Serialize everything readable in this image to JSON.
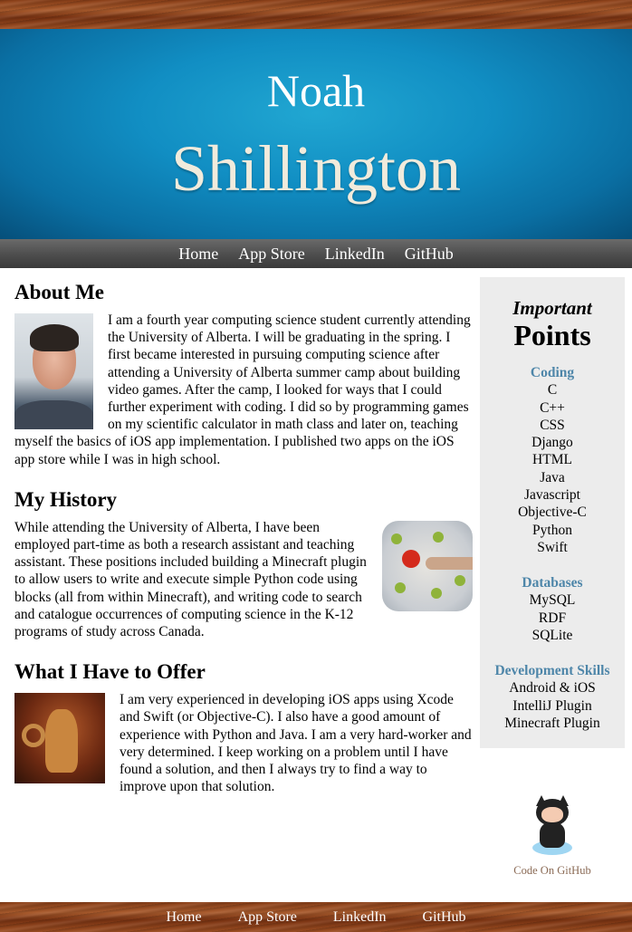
{
  "hero": {
    "first_name": "Noah",
    "last_name": "Shillington"
  },
  "nav": {
    "home": "Home",
    "app_store": "App Store",
    "linkedin": "LinkedIn",
    "github": "GitHub"
  },
  "about": {
    "heading": "About Me",
    "text": "I am a fourth year computing science student currently attending the University of Alberta. I will be graduating in the spring. I first became interested in pursuing computing science after attending a University of Alberta summer camp about building video games. After the camp, I looked for ways that I could further experiment with coding. I did so by programming games on my scientific calculator in math class and later on, teaching myself the basics of iOS app implementation. I published two apps on the iOS app store while I was in high school."
  },
  "history": {
    "heading": "My History",
    "text": "While attending the University of Alberta, I have been employed part-time as both a research assistant and teaching assistant. These positions included building a Minecraft plugin to allow users to write and execute simple Python code using blocks (all from within Minecraft), and writing code to search and catalogue occurrences of computing science in the K-12 programs of study across Canada."
  },
  "offer": {
    "heading": "What I Have to Offer",
    "text": "I am very experienced in developing iOS apps using Xcode and Swift (or Objective-C). I also have a good amount of experience with Python and Java. I am a very hard-worker and very determined. I keep working on a problem until I have found a solution, and then I always try to find a way to improve upon that solution."
  },
  "sidebar": {
    "title_line1": "Important",
    "title_line2": "Points",
    "groups": [
      {
        "heading": "Coding",
        "items": [
          "C",
          "C++",
          "CSS",
          "Django",
          "HTML",
          "Java",
          "Javascript",
          "Objective-C",
          "Python",
          "Swift"
        ]
      },
      {
        "heading": "Databases",
        "items": [
          "MySQL",
          "RDF",
          "SQLite"
        ]
      },
      {
        "heading": "Development Skills",
        "items": [
          "Android & iOS",
          "IntelliJ Plugin",
          "Minecraft Plugin"
        ]
      }
    ]
  },
  "github_badge": {
    "label": "Code On GitHub",
    "icon": "octocat-icon"
  },
  "colors": {
    "hero_blue": "#118ec3",
    "sidebar_heading": "#4e86a9",
    "sidebar_bg": "#ececec",
    "wood": "#8a3f18"
  }
}
